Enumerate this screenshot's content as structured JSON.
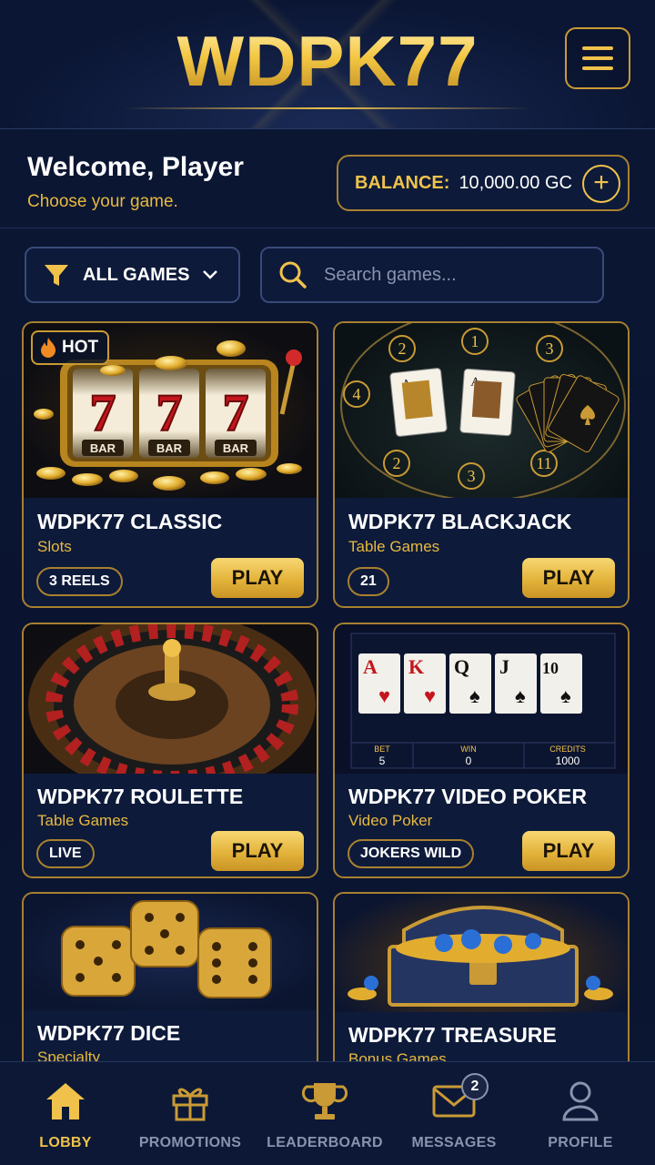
{
  "header": {
    "logo": "WDPK77"
  },
  "welcome": {
    "title": "Welcome, Player",
    "subtitle": "Choose your game."
  },
  "balance": {
    "label": "BALANCE:",
    "value": "10,000.00 GC",
    "add_symbol": "+"
  },
  "filter": {
    "label": "ALL GAMES",
    "icon": "filter-icon"
  },
  "search": {
    "placeholder": "Search games..."
  },
  "games": [
    {
      "title": "WDPK77 CLASSIC",
      "category": "Slots",
      "tag": "3 REELS",
      "play": "PLAY",
      "badge": "HOT",
      "reel_labels": [
        "BAR",
        "BAR",
        "BAR"
      ]
    },
    {
      "title": "WDPK77 BLACKJACK",
      "category": "Table Games",
      "tag": "21",
      "play": "PLAY",
      "seats": [
        "1",
        "2",
        "3",
        "4",
        "2",
        "3",
        "11"
      ]
    },
    {
      "title": "WDPK77 ROULETTE",
      "category": "Table Games",
      "tag": "LIVE",
      "play": "PLAY"
    },
    {
      "title": "WDPK77 VIDEO POKER",
      "category": "Video Poker",
      "tag": "JOKERS WILD",
      "play": "PLAY",
      "cards": [
        "A",
        "K",
        "Q",
        "J",
        "10"
      ],
      "hud": {
        "bet_label": "BET",
        "bet": "5",
        "win_label": "WIN",
        "win": "0",
        "credits_label": "CREDITS",
        "credits": "1000"
      }
    },
    {
      "title": "WDPK77 DICE",
      "category": "Specialty"
    },
    {
      "title": "WDPK77 TREASURE",
      "category": "Bonus Games"
    }
  ],
  "nav": [
    {
      "label": "LOBBY",
      "icon": "home-icon",
      "active": true
    },
    {
      "label": "PROMOTIONS",
      "icon": "gift-icon"
    },
    {
      "label": "LEADERBOARD",
      "icon": "trophy-icon"
    },
    {
      "label": "MESSAGES",
      "icon": "mail-icon",
      "badge": "2"
    },
    {
      "label": "PROFILE",
      "icon": "user-icon"
    }
  ],
  "colors": {
    "gold": "#f0c24b",
    "navy": "#0b1734",
    "muted": "#8a93ad"
  }
}
